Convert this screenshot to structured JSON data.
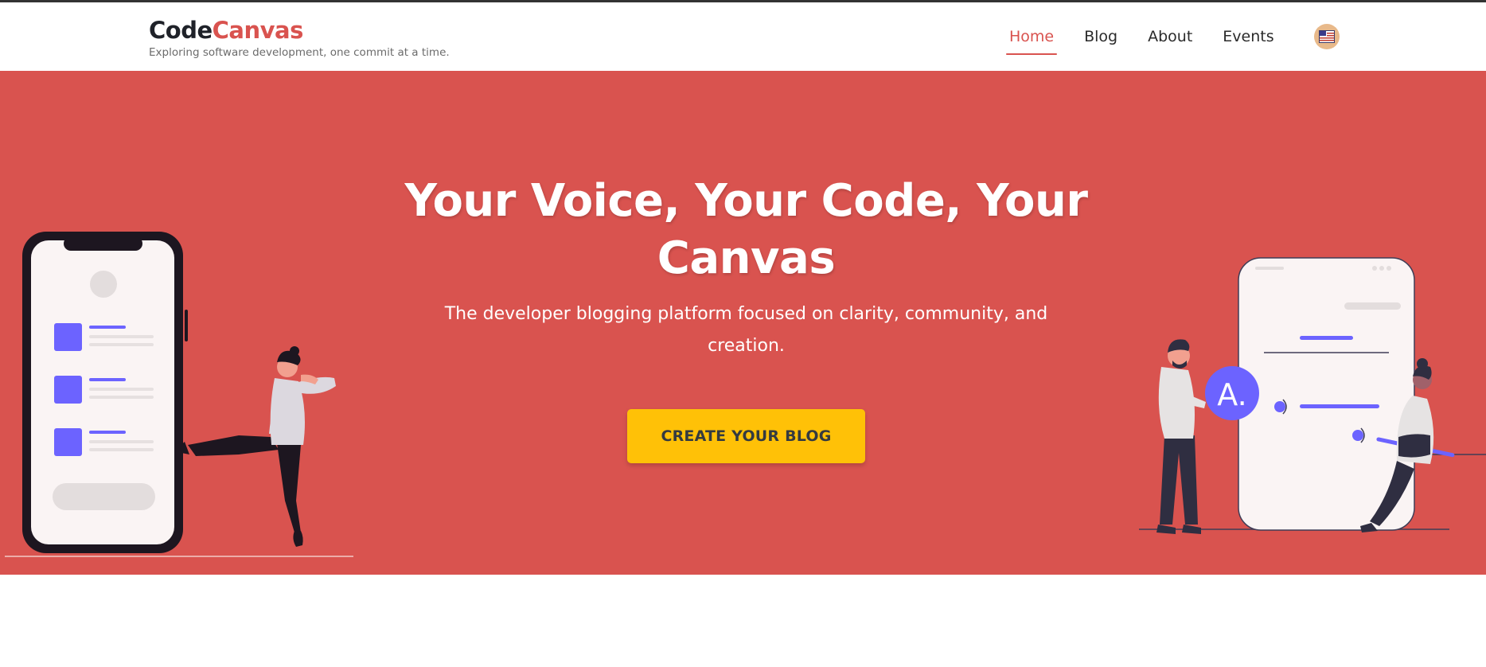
{
  "brand": {
    "name_part1": "Code",
    "name_part2": "Canvas",
    "tagline": "Exploring software development, one commit at a time."
  },
  "nav": {
    "items": [
      {
        "label": "Home",
        "active": true
      },
      {
        "label": "Blog",
        "active": false
      },
      {
        "label": "About",
        "active": false
      },
      {
        "label": "Events",
        "active": false
      }
    ],
    "language_icon": "flag-icon"
  },
  "hero": {
    "title": "Your Voice, Your Code, Your Canvas",
    "subtitle": "The developer blogging platform focused on clarity, community, and creation.",
    "cta_label": "CREATE YOUR BLOG",
    "illustration_right_letter": "A."
  },
  "colors": {
    "accent": "#d9534f",
    "cta": "#ffc107",
    "illustration_purple": "#6c63ff",
    "dark": "#1f2229"
  }
}
